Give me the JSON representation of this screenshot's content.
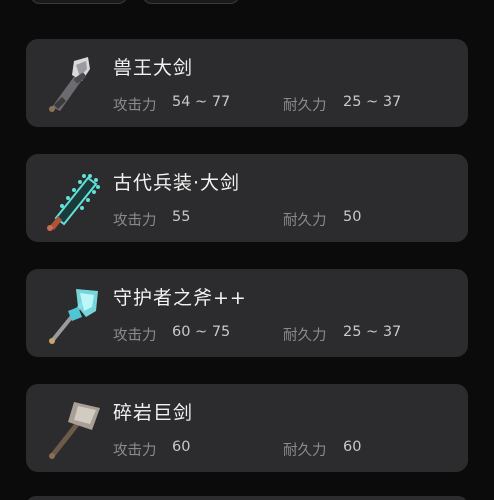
{
  "weapons": [
    {
      "name": "兽王大剑",
      "attack_label": "攻击力",
      "attack": "54 ~ 77",
      "durability_label": "耐久力",
      "durability": "25 ~ 37",
      "icon": "beast-king-greatsword-icon"
    },
    {
      "name": "古代兵装·大剑",
      "attack_label": "攻击力",
      "attack": "55",
      "durability_label": "耐久力",
      "durability": "50",
      "icon": "ancient-greatsword-icon"
    },
    {
      "name": "守护者之斧++",
      "attack_label": "攻击力",
      "attack": "60 ~ 75",
      "durability_label": "耐久力",
      "durability": "25 ~ 37",
      "icon": "guardian-axe-icon"
    },
    {
      "name": "碎岩巨剑",
      "attack_label": "攻击力",
      "attack": "60",
      "durability_label": "耐久力",
      "durability": "60",
      "icon": "cobble-crusher-icon"
    }
  ],
  "colors": {
    "background": "#0b0b0c",
    "card": "#2c2c2e",
    "label": "#8a8a8e",
    "value": "#c8c8cc",
    "ancient_glow": "#5fe0d8"
  }
}
